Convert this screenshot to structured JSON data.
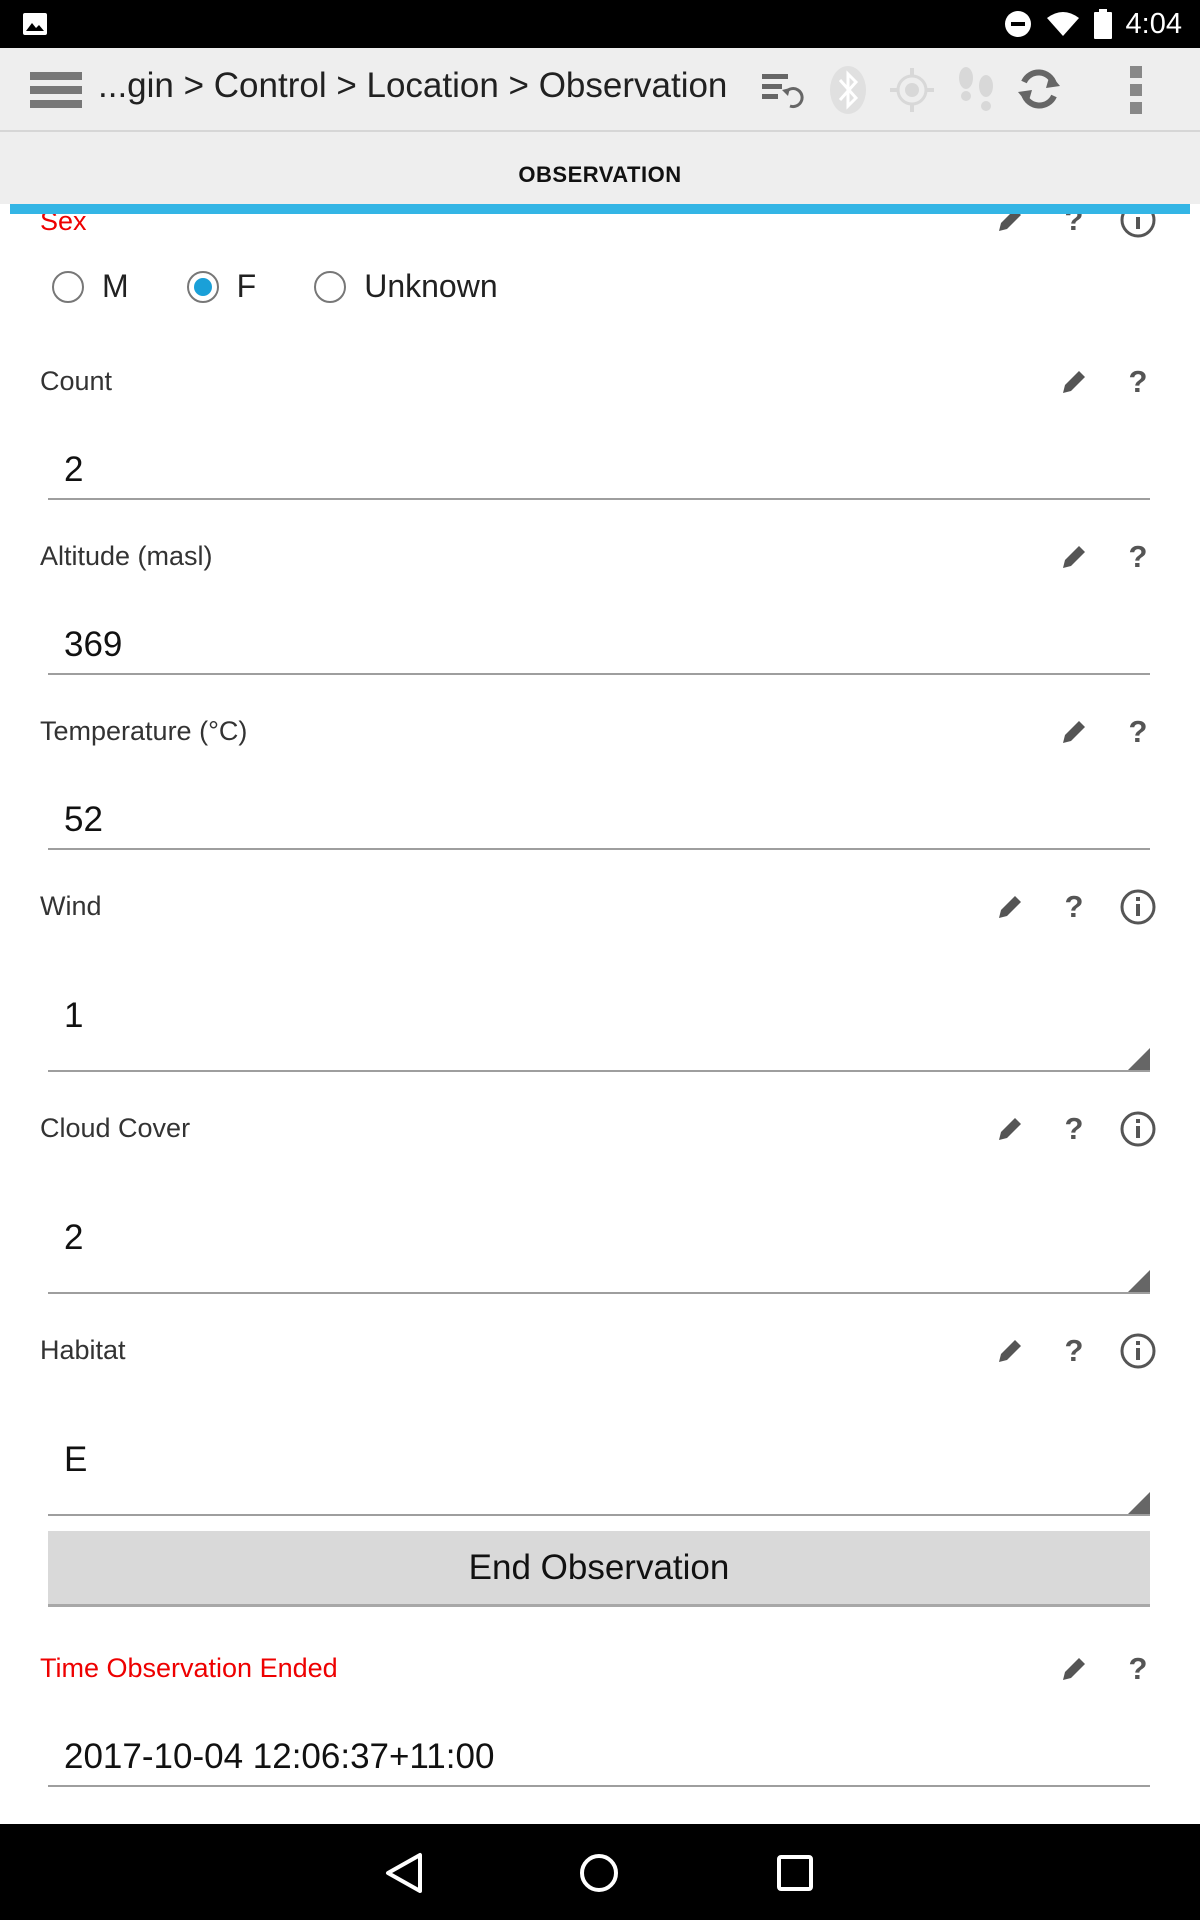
{
  "status_bar": {
    "time": "4:04",
    "icons": [
      "image-icon",
      "do-not-disturb-icon",
      "wifi-icon",
      "battery-icon"
    ]
  },
  "toolbar": {
    "breadcrumb": "...gin > Control > Location > Observation",
    "icons": [
      "menu-icon",
      "sync-data-icon",
      "bluetooth-icon",
      "gps-target-icon",
      "footsteps-icon",
      "refresh-icon",
      "overflow-menu-icon"
    ]
  },
  "tab": {
    "title": "OBSERVATION",
    "accent": "#33b5e5"
  },
  "form": {
    "sex": {
      "label": "Sex",
      "options": [
        "M",
        "F",
        "Unknown"
      ],
      "selected": "F"
    },
    "count": {
      "label": "Count",
      "value": "2"
    },
    "altitude": {
      "label": "Altitude (masl)",
      "value": "369"
    },
    "temperature": {
      "label": "Temperature (°C)",
      "value": "52"
    },
    "wind": {
      "label": "Wind",
      "value": "1"
    },
    "cloud_cover": {
      "label": "Cloud Cover",
      "value": "2"
    },
    "habitat": {
      "label": "Habitat",
      "value": "E"
    },
    "end_button": {
      "label": "End Observation"
    },
    "time_ended": {
      "label": "Time Observation Ended",
      "value": "2017-10-04 12:06:37+11:00"
    }
  },
  "colors": {
    "required_label": "#ee0000",
    "radio_selected": "#1aa0d8"
  }
}
